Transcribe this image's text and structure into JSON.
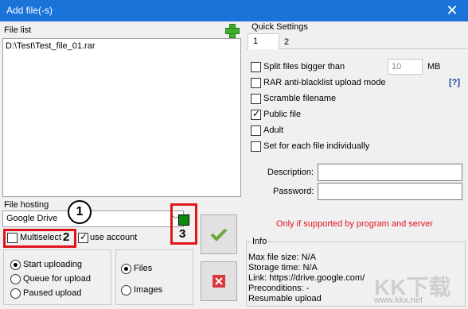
{
  "window": {
    "title": "Add file(-s)",
    "close_label": "✕"
  },
  "file_list": {
    "label": "File list",
    "items": [
      "D:\\Test\\Test_file_01.rar"
    ]
  },
  "file_hosting": {
    "label": "File hosting",
    "selected": "Google Drive",
    "multiselect_label": "Multiselect",
    "use_account_label": "use account",
    "use_account_checked": true,
    "multiselect_checked": false
  },
  "upload_mode": {
    "options": [
      "Start uploading",
      "Queue for upload",
      "Paused upload"
    ],
    "selected_index": 0
  },
  "content_type": {
    "options": [
      "Files",
      "Images"
    ],
    "selected_index": 0
  },
  "annotations": {
    "badge1": "1",
    "badge2": "2",
    "badge3": "3"
  },
  "quick_settings": {
    "label": "Quick Settings",
    "tabs": [
      "1",
      "2"
    ],
    "split_label": "Split files bigger than",
    "split_value": "10",
    "split_unit": "MB",
    "rar_label": "RAR anti-blacklist upload mode",
    "rar_help": "[?]",
    "scramble_label": "Scramble filename",
    "public_label": "Public file",
    "adult_label": "Adult",
    "each_file_label": "Set for each file individually",
    "description_label": "Description:",
    "password_label": "Password:",
    "note": "Only if supported by program and server",
    "checked": {
      "split": false,
      "rar": false,
      "scramble": false,
      "public": true,
      "adult": false,
      "each_file": false
    }
  },
  "info": {
    "label": "Info",
    "max_file_size": "Max file size: N/A",
    "storage_time": "Storage time: N/A",
    "link": "Link: https://drive.google.com/",
    "preconditions": "Preconditions: -",
    "resumable": "Resumable upload"
  },
  "watermark": {
    "text": "KK下载",
    "url": "www.kkx.net"
  },
  "colors": {
    "titlebar": "#1a73d9",
    "annotation_red": "#e0141e",
    "note_red": "#e0141e",
    "accept_green": "#2e8b2e"
  }
}
